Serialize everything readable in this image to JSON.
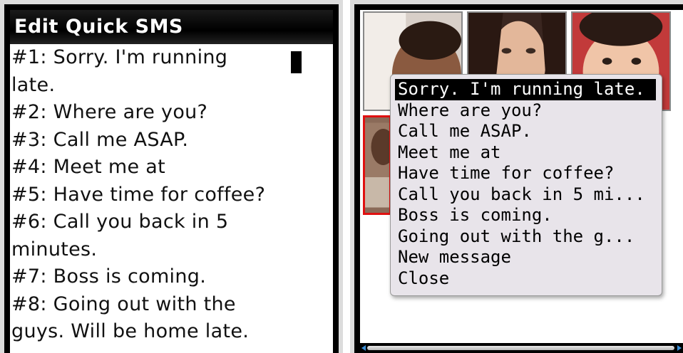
{
  "left": {
    "title": "Edit Quick SMS",
    "lines": [
      "#1: Sorry. I'm running",
      "late.",
      "#2: Where are you?",
      "#3: Call me ASAP.",
      "#4: Meet me at",
      "#5: Have time for coffee?",
      "#6: Call you back in 5",
      "minutes.",
      "#7: Boss is coming.",
      "#8: Going out with the",
      "guys.  Will be home late."
    ]
  },
  "right": {
    "menu": [
      {
        "label": "Sorry. I'm running late.",
        "selected": true
      },
      {
        "label": "Where are you?",
        "selected": false
      },
      {
        "label": "Call me ASAP.",
        "selected": false
      },
      {
        "label": "Meet me at",
        "selected": false
      },
      {
        "label": "Have time for coffee?",
        "selected": false
      },
      {
        "label": "Call you back in 5 mi...",
        "selected": false
      },
      {
        "label": "Boss is coming.",
        "selected": false
      },
      {
        "label": "Going out with the g...",
        "selected": false
      },
      {
        "label": "New message",
        "selected": false
      },
      {
        "label": "Close",
        "selected": false
      }
    ],
    "contact_photos": [
      "photo-man",
      "photo-woman",
      "photo-child",
      "photo-selected"
    ]
  },
  "colors": {
    "selection_border": "#e01010",
    "scroll_arrow": "#3a8fd8",
    "popup_bg": "#e8e4ea"
  }
}
